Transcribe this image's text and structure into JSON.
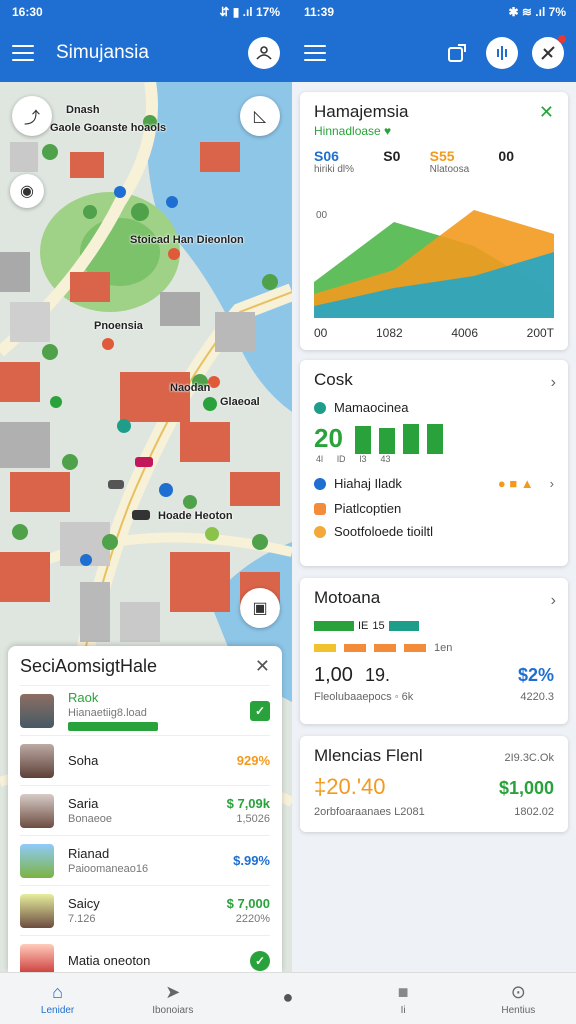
{
  "status_left": {
    "time": "16:30",
    "icons": "⇵ ▮ .ıl 17%"
  },
  "status_right": {
    "time": "11:39",
    "icons": "✱ ≋ .ıl 7%"
  },
  "app": {
    "title": "Simujansia"
  },
  "map": {
    "labels": [
      "Dnash",
      "Gaole Goanste hoaols",
      "Stoicad Han Dieonlon",
      "Pnoensia",
      "Naodan",
      "Glaeoal",
      "Hoade Heoton"
    ]
  },
  "sheet": {
    "title": "SeciAomsigtHale",
    "rows": [
      {
        "name": "Raok",
        "sub": "Hianaetiig8.load",
        "value": "",
        "value_sub": "",
        "color": "#2aa23b",
        "progress": 0.6
      },
      {
        "name": "Soha",
        "sub": "",
        "value": "929%",
        "value_sub": "",
        "color": "#f29a1f"
      },
      {
        "name": "Saria",
        "sub": "Bonaeoe",
        "value": "$ 7,09k",
        "value_sub": "1,5026",
        "color": "#2aa23b"
      },
      {
        "name": "Rianad",
        "sub": "Paioomaneao16",
        "value": "$.99%",
        "value_sub": "",
        "color": "#1e6fd1"
      },
      {
        "name": "Saicy",
        "sub": "7.126",
        "value": "$ 7,000",
        "value_sub": "2220%",
        "color": "#2aa23b"
      },
      {
        "name": "Matia oneoton",
        "sub": "",
        "value": "",
        "value_sub": "",
        "color": "#2aa23b"
      }
    ]
  },
  "card_chart": {
    "title": "Hamajemsia",
    "subtitle": "Hinnadloase ♥",
    "stats": [
      {
        "num": "S06",
        "lbl": "hiriki dl%",
        "color": "#1e6fd1"
      },
      {
        "num": "S0",
        "lbl": "",
        "color": "#222"
      },
      {
        "num": "S55",
        "lbl": "Nlatoosa",
        "color": "#f29a1f"
      },
      {
        "num": "00",
        "lbl": "",
        "color": "#222"
      }
    ],
    "y_label": "00",
    "x_ticks": [
      "00",
      "1082",
      "4006",
      "200T"
    ]
  },
  "chart_data": {
    "type": "area",
    "title": "Hamajemsia",
    "x": [
      "00",
      "1082",
      "4006",
      "200T"
    ],
    "series": [
      {
        "values": [
          30,
          80,
          60,
          20
        ],
        "color": "#4fb84a"
      },
      {
        "values": [
          20,
          40,
          90,
          70
        ],
        "color": "#f29a1f"
      },
      {
        "values": [
          10,
          25,
          35,
          55
        ],
        "color": "#22a6c6"
      }
    ]
  },
  "card_cask": {
    "title": "Cosk",
    "item1": "Mamaocinea",
    "big_num": "20",
    "bar_labels": [
      "4l",
      "lD",
      "l3",
      "43"
    ],
    "item2": "Hiahaj Iladk",
    "item3": "Piatlcoptien",
    "item4": "Sootfoloede tioiltl"
  },
  "card_motoana": {
    "title": "Motoana",
    "tag1": "IE",
    "tag2": "15",
    "tag3": "1en",
    "val1": "1,00",
    "val2": "19.",
    "val3": "$2%",
    "foot_left": "Fleolubaaepocs ◦ 6k",
    "foot_right": "4220.3"
  },
  "card_fund": {
    "title": "Mlencias Flenl",
    "right_top": "2I9.3C.Ok",
    "big": "‡20.'40",
    "big_right": "$1,000",
    "foot_left": "2orbfoaraanaes L2081",
    "foot_right": "1802.02"
  },
  "nav": {
    "items": [
      {
        "label": "Lenider",
        "icon": "⌂",
        "active": true
      },
      {
        "label": "Ibonoiars",
        "icon": "➤",
        "active": false
      },
      {
        "label": "",
        "icon": "●",
        "active": false
      },
      {
        "label": "Ii",
        "icon": "■",
        "active": false
      },
      {
        "label": "Hentius",
        "icon": "⊙",
        "active": false
      }
    ]
  }
}
